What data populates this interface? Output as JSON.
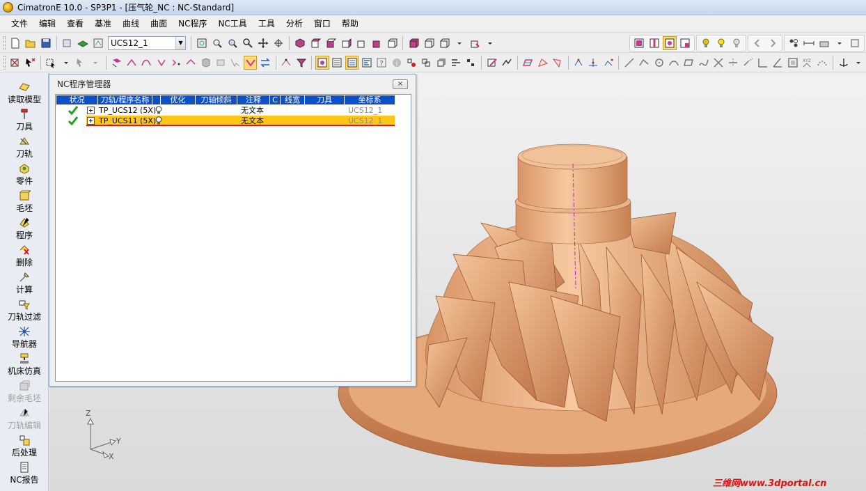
{
  "window": {
    "title": "CimatronE 10.0 - SP3P1 - [压气轮_NC : NC-Standard]"
  },
  "menu": [
    "文件",
    "编辑",
    "查看",
    "基准",
    "曲线",
    "曲面",
    "NC程序",
    "NC工具",
    "工具",
    "分析",
    "窗口",
    "帮助"
  ],
  "toolbar": {
    "ucs_combo_value": "UCS12_1"
  },
  "sidebar": {
    "items": [
      {
        "label": "读取模型",
        "icon": "load-model-icon",
        "enabled": true
      },
      {
        "label": "刀具",
        "icon": "tool-icon",
        "enabled": true
      },
      {
        "label": "刀轨",
        "icon": "toolpath-icon",
        "enabled": true
      },
      {
        "label": "零件",
        "icon": "part-icon",
        "enabled": true
      },
      {
        "label": "毛坯",
        "icon": "stock-icon",
        "enabled": true
      },
      {
        "label": "程序",
        "icon": "procedure-icon",
        "enabled": true
      },
      {
        "label": "删除",
        "icon": "delete-icon",
        "enabled": true
      },
      {
        "label": "计算",
        "icon": "execute-icon",
        "enabled": true
      },
      {
        "label": "刀轨过滤",
        "icon": "filter-icon",
        "enabled": true
      },
      {
        "label": "导航器",
        "icon": "navigator-icon",
        "enabled": true
      },
      {
        "label": "机床仿真",
        "icon": "machine-sim-icon",
        "enabled": true
      },
      {
        "label": "剩余毛坯",
        "icon": "remaining-stock-icon",
        "enabled": false
      },
      {
        "label": "刀轨编辑",
        "icon": "toolpath-edit-icon",
        "enabled": false
      },
      {
        "label": "后处理",
        "icon": "post-process-icon",
        "enabled": true
      },
      {
        "label": "NC报告",
        "icon": "nc-report-icon",
        "enabled": true
      }
    ]
  },
  "nc_manager": {
    "title": "NC程序管理器",
    "close_label": "×",
    "columns": [
      "状况",
      "刀轨/程序名称",
      "优化",
      "刀轴倾斜",
      "注释",
      "C",
      "线宽",
      "刀具",
      "坐标系"
    ],
    "rows": [
      {
        "name": "TP_UCS12 (5X)",
        "comment": "无文本",
        "ucs": "UCS12_1",
        "status": "ok",
        "selected": false
      },
      {
        "name": "TP_UCS11 (5X)",
        "comment": "无文本",
        "ucs": "UCS12_1",
        "status": "ok",
        "selected": true
      }
    ]
  },
  "axes": {
    "z": "Z",
    "y": "Y",
    "x": "X"
  },
  "watermark": "三维网www.3dportal.cn",
  "colors": {
    "model": "#e8a878",
    "selection": "#ffc61a",
    "header": "#0d50c8"
  }
}
